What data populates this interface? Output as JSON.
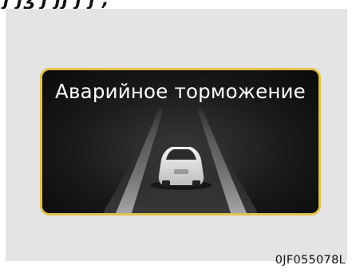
{
  "warning_display": {
    "message": "Аварийное торможение",
    "frame_color": "#e2c24d",
    "icon": "car-rear-icon"
  },
  "figure_code": "0JF055078L"
}
